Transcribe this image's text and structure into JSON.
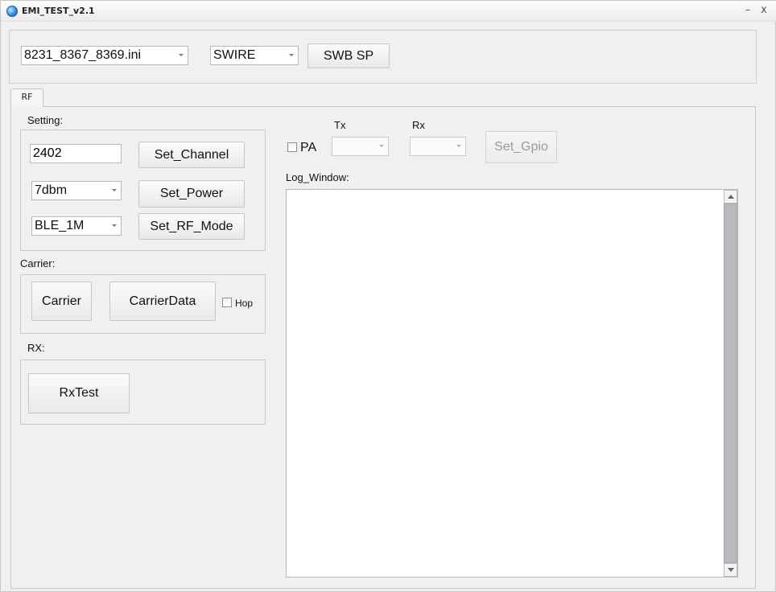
{
  "window": {
    "title": "EMI_TEST_v2.1",
    "minimize_glyph": "–",
    "close_glyph": "x"
  },
  "top": {
    "config_file": "8231_8367_8369.ini",
    "interface": "SWIRE",
    "swb_sp_label": "SWB SP"
  },
  "tabs": [
    {
      "label": "RF"
    }
  ],
  "setting": {
    "label": "Setting:",
    "channel_value": "2402",
    "set_channel_label": "Set_Channel",
    "power_value": "7dbm",
    "set_power_label": "Set_Power",
    "rf_mode_value": "BLE_1M",
    "set_rf_mode_label": "Set_RF_Mode"
  },
  "carrier": {
    "label": "Carrier:",
    "carrier_label": "Carrier",
    "carrier_data_label": "CarrierData",
    "hop_label": "Hop"
  },
  "rx": {
    "label": "RX:",
    "rx_test_label": "RxTest"
  },
  "pa": {
    "pa_label": "PA",
    "tx_label": "Tx",
    "rx_label": "Rx",
    "tx_value": "",
    "rx_value": "",
    "set_gpio_label": "Set_Gpio"
  },
  "log": {
    "label": "Log_Window:",
    "content": ""
  }
}
